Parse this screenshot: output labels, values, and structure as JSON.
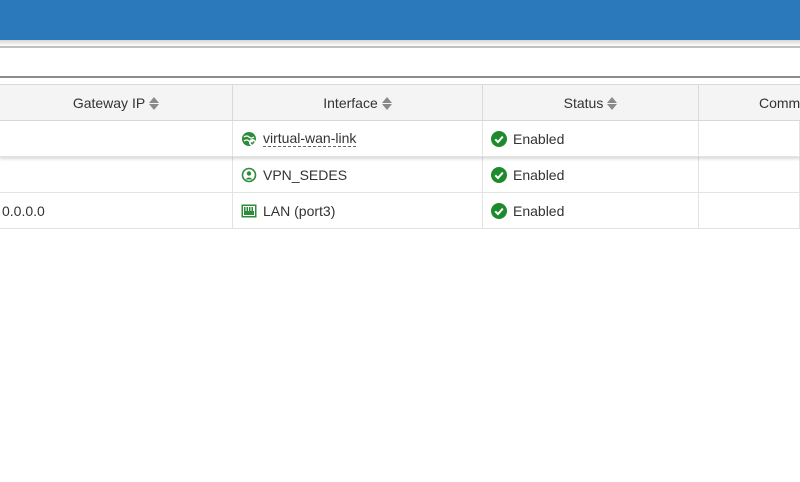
{
  "colors": {
    "topbar": "#2b78ba",
    "enabled": "#1e8a2e",
    "interface_icon": "#2e8b3a"
  },
  "table": {
    "columns": {
      "gateway_ip": "Gateway IP",
      "interface": "Interface",
      "status": "Status",
      "comments": "Comm"
    },
    "rows": [
      {
        "gateway_ip": "",
        "interface": "virtual-wan-link",
        "interface_icon": "sdwan-globe-icon",
        "status": "Enabled"
      },
      {
        "gateway_ip": "",
        "interface": "VPN_SEDES",
        "interface_icon": "vpn-tunnel-icon",
        "status": "Enabled"
      },
      {
        "gateway_ip": "0.0.0.0",
        "interface": "LAN (port3)",
        "interface_icon": "ethernet-port-icon",
        "status": "Enabled"
      }
    ]
  }
}
